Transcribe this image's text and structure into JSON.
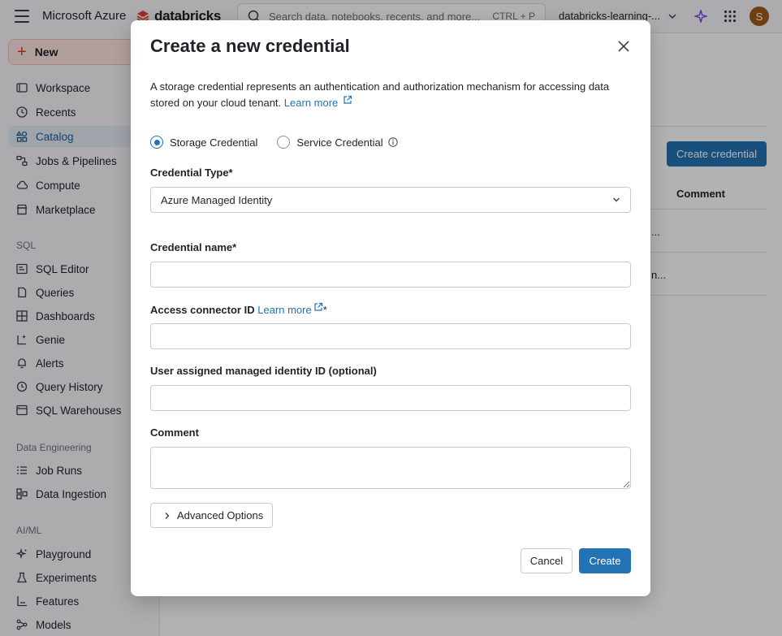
{
  "topbar": {
    "brand": "Microsoft Azure",
    "logo_text": "databricks",
    "search_placeholder": "Search data, notebooks, recents, and more...",
    "search_shortcut": "CTRL + P",
    "workspace": "databricks-learning-...",
    "avatar_initial": "S"
  },
  "sidebar": {
    "new_label": "New",
    "items": [
      {
        "label": "Workspace",
        "icon": "folder-icon"
      },
      {
        "label": "Recents",
        "icon": "clock-icon"
      },
      {
        "label": "Catalog",
        "icon": "catalog-icon"
      },
      {
        "label": "Jobs & Pipelines",
        "icon": "workflow-icon"
      },
      {
        "label": "Compute",
        "icon": "cloud-icon"
      },
      {
        "label": "Marketplace",
        "icon": "store-icon"
      }
    ],
    "sql_label": "SQL",
    "sql_items": [
      {
        "label": "SQL Editor",
        "icon": "editor-icon"
      },
      {
        "label": "Queries",
        "icon": "query-icon"
      },
      {
        "label": "Dashboards",
        "icon": "dashboard-icon"
      },
      {
        "label": "Genie",
        "icon": "genie-icon"
      },
      {
        "label": "Alerts",
        "icon": "bell-icon"
      },
      {
        "label": "Query History",
        "icon": "history-icon"
      },
      {
        "label": "SQL Warehouses",
        "icon": "warehouse-icon"
      }
    ],
    "de_label": "Data Engineering",
    "de_items": [
      {
        "label": "Job Runs",
        "icon": "list-icon"
      },
      {
        "label": "Data Ingestion",
        "icon": "ingest-icon"
      }
    ],
    "ai_label": "AI/ML",
    "ai_items": [
      {
        "label": "Playground",
        "icon": "sparkle-icon"
      },
      {
        "label": "Experiments",
        "icon": "flask-icon"
      },
      {
        "label": "Features",
        "icon": "features-icon"
      },
      {
        "label": "Models",
        "icon": "model-icon"
      }
    ]
  },
  "background": {
    "create_button": "Create credential",
    "comment_header": "Comment",
    "row1": "...",
    "row2": "n..."
  },
  "modal": {
    "title": "Create a new credential",
    "description": "A storage credential represents an authentication and authorization mechanism for accessing data stored on your cloud tenant.",
    "learn_more": "Learn more",
    "radio_storage": "Storage Credential",
    "radio_service": "Service Credential",
    "credential_type_label": "Credential Type*",
    "credential_type_value": "Azure Managed Identity",
    "credential_name_label": "Credential name*",
    "access_connector_label": "Access connector ID",
    "access_connector_link": "Learn more",
    "access_connector_required": "*",
    "user_identity_label": "User assigned managed identity ID (optional)",
    "comment_label": "Comment",
    "advanced_options": "Advanced Options",
    "cancel": "Cancel",
    "create": "Create"
  },
  "colors": {
    "primary": "#2272b4",
    "new_accent": "#d13a26",
    "avatar": "#a25a1a"
  }
}
